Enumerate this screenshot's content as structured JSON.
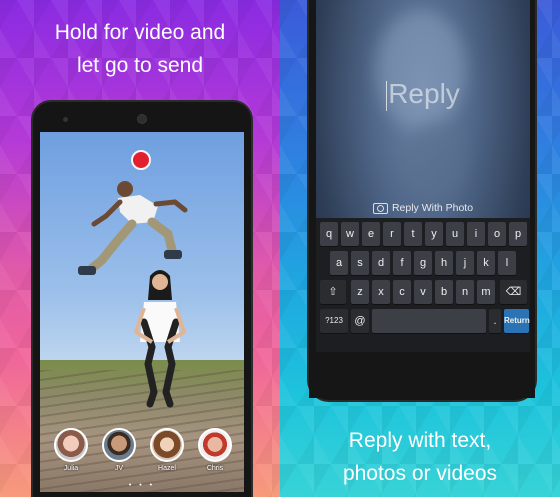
{
  "left": {
    "caption_line1": "Hold for video and",
    "caption_line2": "let go to send",
    "contacts": [
      {
        "name": "Julia"
      },
      {
        "name": "JV"
      },
      {
        "name": "Hazel"
      },
      {
        "name": "Chris"
      }
    ],
    "page_indicator": "• • •",
    "colors": {
      "record": "#e3202f"
    }
  },
  "right": {
    "reply_placeholder": "Reply",
    "reply_with_photo": "Reply With Photo",
    "caption_line1": "Reply with text,",
    "caption_line2": "photos or videos",
    "keyboard": {
      "row1": [
        "q",
        "w",
        "e",
        "r",
        "t",
        "y",
        "u",
        "i",
        "o",
        "p"
      ],
      "row2": [
        "a",
        "s",
        "d",
        "f",
        "g",
        "h",
        "j",
        "k",
        "l"
      ],
      "row3": [
        "z",
        "x",
        "c",
        "v",
        "b",
        "n",
        "m"
      ],
      "shift": "⇧",
      "backspace": "⌫",
      "sym_key": "?123",
      "at_key": "@",
      "dot_key": ".",
      "return_key": "Return"
    }
  }
}
